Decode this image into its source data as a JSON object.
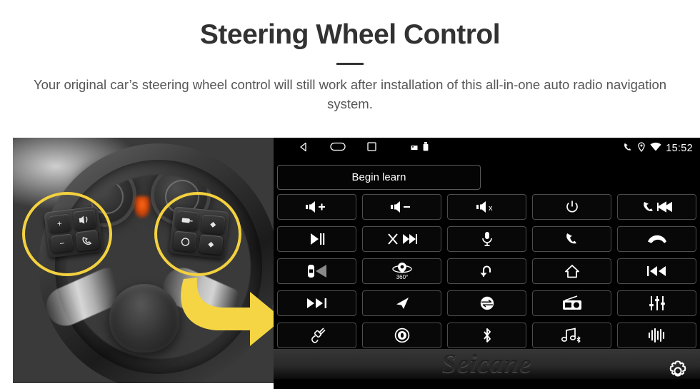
{
  "header": {
    "title": "Steering Wheel Control",
    "subtitle": "Your original car’s steering wheel control will still work after installation of this all-in-one auto radio navigation system."
  },
  "colors": {
    "accent_yellow": "#F3D13F",
    "arrow_yellow": "#F5D543",
    "title_text": "#323232",
    "subtitle_text": "#555555",
    "screen_background": "#000000",
    "button_border": "#4D4D4D"
  },
  "photo": {
    "description": "Grayscale close-up of a car steering wheel with instrument cluster behind it",
    "highlights": [
      {
        "name": "left-swc-cluster",
        "shape": "circle",
        "color": "#F3D13F"
      },
      {
        "name": "right-swc-cluster",
        "shape": "circle",
        "color": "#F3D13F"
      }
    ],
    "arrow": {
      "name": "curved-right-arrow",
      "color": "#F5D543"
    },
    "left_pad_keys": [
      "+",
      "−",
      "voice",
      "call"
    ],
    "right_pad_keys": [
      "source",
      "up",
      "enter",
      "down"
    ]
  },
  "head_unit": {
    "status_bar": {
      "nav_icons": [
        "back-icon",
        "home-icon",
        "recents-icon"
      ],
      "system_icons": [
        "sd-card-icon",
        "usb-icon"
      ],
      "right_icons": [
        "phone-icon",
        "location-icon",
        "wifi-icon"
      ],
      "clock": "15:52"
    },
    "begin_learn_label": "Begin learn",
    "watermark": "Seicane",
    "settings_button": "gear-icon",
    "buttons": [
      {
        "icon": "volume-up-icon",
        "label": "Volume Up"
      },
      {
        "icon": "volume-down-icon",
        "label": "Volume Down"
      },
      {
        "icon": "mute-icon",
        "label": "Mute"
      },
      {
        "icon": "power-icon",
        "label": "Power"
      },
      {
        "icon": "phone-previous-icon",
        "label": "Phone / Previous"
      },
      {
        "icon": "play-pause-icon",
        "label": "Play / Pause"
      },
      {
        "icon": "shuffle-next-icon",
        "label": "Shuffle / Next"
      },
      {
        "icon": "microphone-icon",
        "label": "Voice"
      },
      {
        "icon": "phone-answer-icon",
        "label": "Answer Call"
      },
      {
        "icon": "phone-hangup-icon",
        "label": "End Call"
      },
      {
        "icon": "rear-camera-icon",
        "label": "Rear Camera"
      },
      {
        "icon": "camera-360-icon",
        "label": "360° Camera"
      },
      {
        "icon": "back-arrow-icon",
        "label": "Back"
      },
      {
        "icon": "home-house-icon",
        "label": "Home"
      },
      {
        "icon": "previous-track-icon",
        "label": "Previous Track"
      },
      {
        "icon": "next-track-icon",
        "label": "Next Track"
      },
      {
        "icon": "navigation-arrow-icon",
        "label": "Navigation"
      },
      {
        "icon": "source-mode-icon",
        "label": "Mode / Source"
      },
      {
        "icon": "radio-icon",
        "label": "Radio"
      },
      {
        "icon": "equalizer-icon",
        "label": "Equalizer"
      },
      {
        "icon": "aux-plug-icon",
        "label": "AUX"
      },
      {
        "icon": "disc-icon",
        "label": "Disc"
      },
      {
        "icon": "bluetooth-icon",
        "label": "Bluetooth"
      },
      {
        "icon": "bluetooth-music-icon",
        "label": "Bluetooth Music"
      },
      {
        "icon": "voice-wave-icon",
        "label": "Voice Wave"
      }
    ]
  }
}
